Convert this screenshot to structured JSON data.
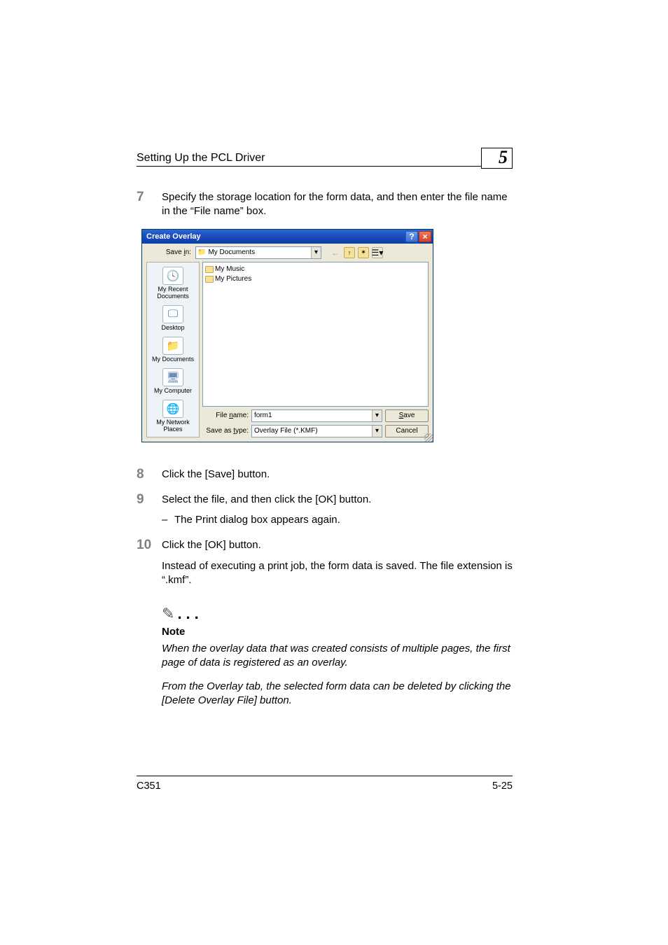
{
  "header": {
    "title": "Setting Up the PCL Driver",
    "chapter": "5"
  },
  "steps": {
    "s7": {
      "num": "7",
      "text": "Specify the storage location for the form data, and then enter the file name in the “File name” box."
    },
    "s8": {
      "num": "8",
      "text": "Click the [Save] button."
    },
    "s9": {
      "num": "9",
      "text": "Select the file, and then click the [OK] button.",
      "sub": "The Print dialog box appears again."
    },
    "s10": {
      "num": "10",
      "text": "Click the [OK] button.",
      "para2": "Instead of executing a print job, the form data is saved. The file extension is “.kmf”."
    }
  },
  "dialog": {
    "title": "Create Overlay",
    "savein_label": "Save in:",
    "savein_value": "My Documents",
    "back_icon": "←",
    "up_glyph": "📁",
    "newfolder_glyph": "📂",
    "views_glyph": "☰",
    "places": {
      "recent": "My Recent Documents",
      "desktop": "Desktop",
      "mydocs": "My Documents",
      "mycomp": "My Computer",
      "mynet": "My Network Places"
    },
    "files": {
      "f1": "My Music",
      "f2": "My Pictures"
    },
    "filename_label": "File name:",
    "filename_value": "form1",
    "saveas_label": "Save as type:",
    "saveas_value": "Overlay File (*.KMF)",
    "save_btn": "Save",
    "cancel_btn": "Cancel"
  },
  "note": {
    "label": "Note",
    "p1": "When the overlay data that was created consists of multiple pages, the first page of data is registered as an overlay.",
    "p2": "From the Overlay tab, the selected form data can be deleted by clicking the [Delete Overlay File] button."
  },
  "footer": {
    "model": "C351",
    "page": "5-25"
  }
}
